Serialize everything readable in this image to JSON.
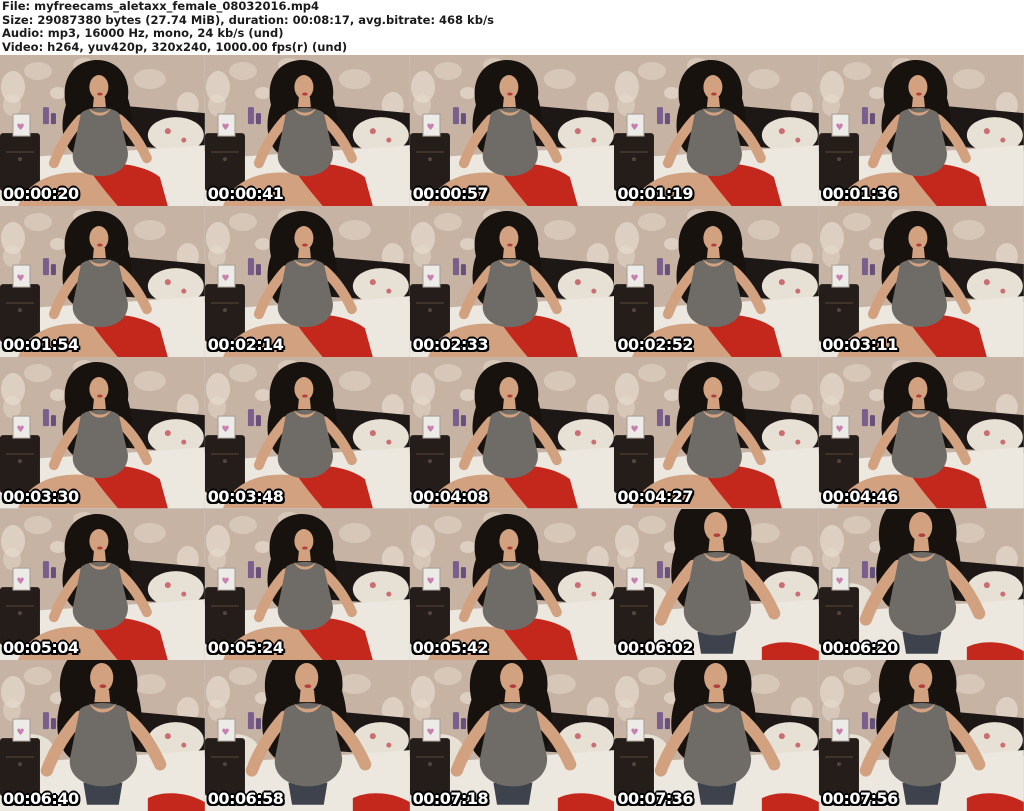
{
  "header": {
    "file": {
      "label": "File:",
      "value": "myfreecams_aletaxx_female_08032016.mp4"
    },
    "size": {
      "label": "Size:",
      "value": "29087380 bytes (27.74 MiB), duration: 00:08:17, avg.bitrate: 468 kb/s"
    },
    "audio": {
      "label": "Audio:",
      "value": "mp3, 16000 Hz, mono, 24 kb/s (und)"
    },
    "video": {
      "label": "Video:",
      "value": "h264, yuv420p, 320x240, 1000.00 fps(r) (und)"
    }
  },
  "thumbnails": {
    "grid": {
      "columns": 5,
      "rows": 5
    },
    "frames": [
      {
        "timestamp": "00:00:20",
        "pose": "seated"
      },
      {
        "timestamp": "00:00:41",
        "pose": "seated"
      },
      {
        "timestamp": "00:00:57",
        "pose": "seated"
      },
      {
        "timestamp": "00:01:19",
        "pose": "seated"
      },
      {
        "timestamp": "00:01:36",
        "pose": "seated"
      },
      {
        "timestamp": "00:01:54",
        "pose": "seated"
      },
      {
        "timestamp": "00:02:14",
        "pose": "seated"
      },
      {
        "timestamp": "00:02:33",
        "pose": "seated"
      },
      {
        "timestamp": "00:02:52",
        "pose": "seated"
      },
      {
        "timestamp": "00:03:11",
        "pose": "seated"
      },
      {
        "timestamp": "00:03:30",
        "pose": "seated"
      },
      {
        "timestamp": "00:03:48",
        "pose": "seated"
      },
      {
        "timestamp": "00:04:08",
        "pose": "seated"
      },
      {
        "timestamp": "00:04:27",
        "pose": "seated"
      },
      {
        "timestamp": "00:04:46",
        "pose": "seated"
      },
      {
        "timestamp": "00:05:04",
        "pose": "seated"
      },
      {
        "timestamp": "00:05:24",
        "pose": "seated"
      },
      {
        "timestamp": "00:05:42",
        "pose": "seated"
      },
      {
        "timestamp": "00:06:02",
        "pose": "standing"
      },
      {
        "timestamp": "00:06:20",
        "pose": "standing"
      },
      {
        "timestamp": "00:06:40",
        "pose": "standing"
      },
      {
        "timestamp": "00:06:58",
        "pose": "standing"
      },
      {
        "timestamp": "00:07:18",
        "pose": "standing"
      },
      {
        "timestamp": "00:07:36",
        "pose": "standing"
      },
      {
        "timestamp": "00:07:56",
        "pose": "standing"
      }
    ]
  },
  "colors": {
    "header_bg": "#ffffff",
    "header_text": "#1a1a1a",
    "timestamp_text": "#ffffff",
    "wall": "#c6b3a4",
    "bed": "#ece7df",
    "hair": "#17120e",
    "top": "#6f6b66",
    "skin": "#d2a180",
    "red": "#c4271c",
    "nightstand": "#241d19",
    "candle": "#7a5f8e"
  }
}
